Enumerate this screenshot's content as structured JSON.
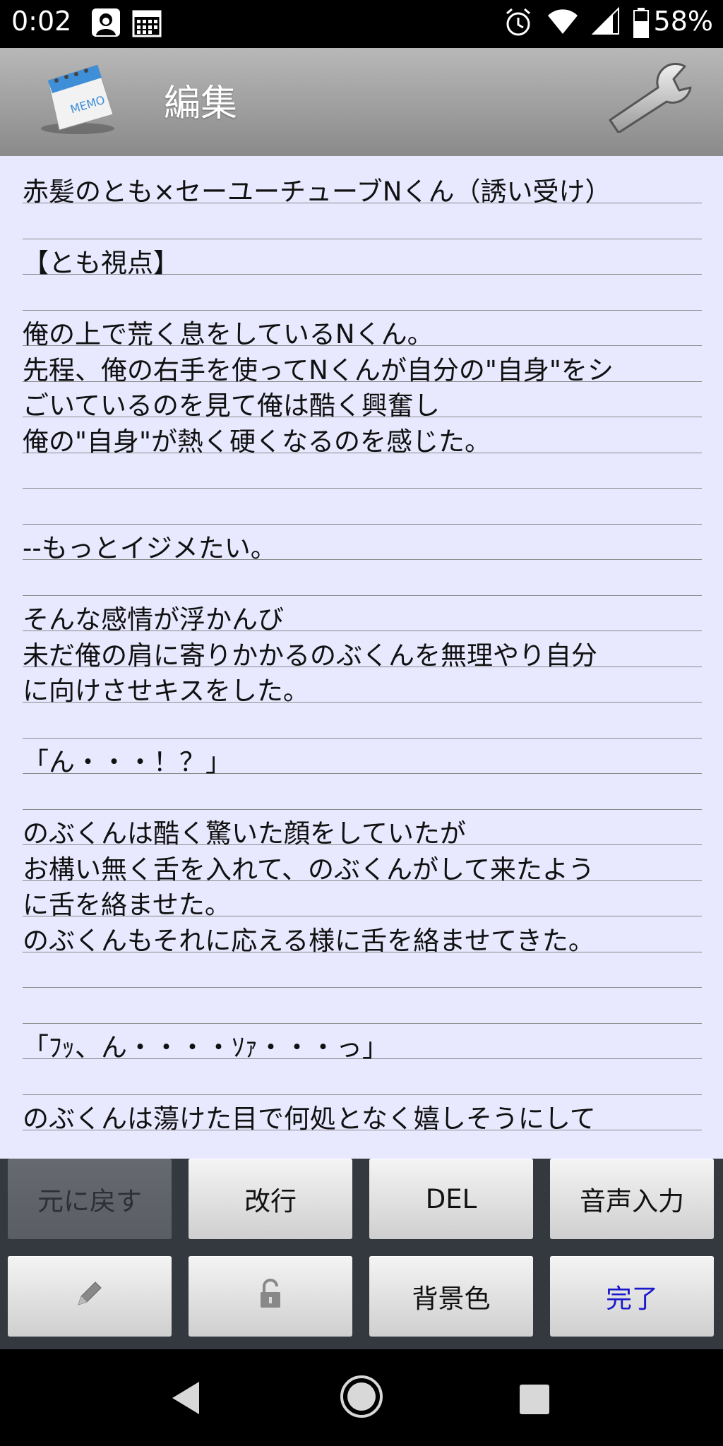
{
  "status_bar": {
    "time": "0:02",
    "battery": "58%",
    "icons": [
      "avatar-icon",
      "calendar-icon",
      "alarm-icon",
      "wifi-icon",
      "signal-icon",
      "battery-icon"
    ]
  },
  "header": {
    "title": "編集",
    "logo_label": "MEMO"
  },
  "editor": {
    "lines": [
      "赤髪のとも×セーユーチューブNくん（誘い受け）",
      "",
      "【とも視点】",
      "",
      "俺の上で荒く息をしているNくん。",
      "先程、俺の右手を使ってNくんが自分の\"自身\"をシ",
      "ごいているのを見て俺は酷く興奮し",
      "俺の\"自身\"が熱く硬くなるのを感じた。",
      "",
      "",
      "--もっとイジメたい。",
      "",
      "そんな感情が浮かんび",
      "未だ俺の肩に寄りかかるのぶくんを無理やり自分",
      "に向けさせキスをした。",
      "",
      "「ん・・・！？」",
      "",
      "のぶくんは酷く驚いた顔をしていたが",
      "お構い無く舌を入れて、のぶくんがして来たよう",
      "に舌を絡ませた。",
      "のぶくんもそれに応える様に舌を絡ませてきた。",
      "",
      "",
      "「ﾌｯ、ん・・・・ｿｧ・・・っ」",
      "",
      "のぶくんは蕩けた目で何処となく嬉しそうにして"
    ]
  },
  "buttons": {
    "undo": "元に戻す",
    "newline": "改行",
    "delete": "DEL",
    "voice_input": "音声入力",
    "background_color": "背景色",
    "done": "完了"
  },
  "colors": {
    "editor_bg": "#e8e8ff",
    "done_text": "#1a1acc"
  }
}
